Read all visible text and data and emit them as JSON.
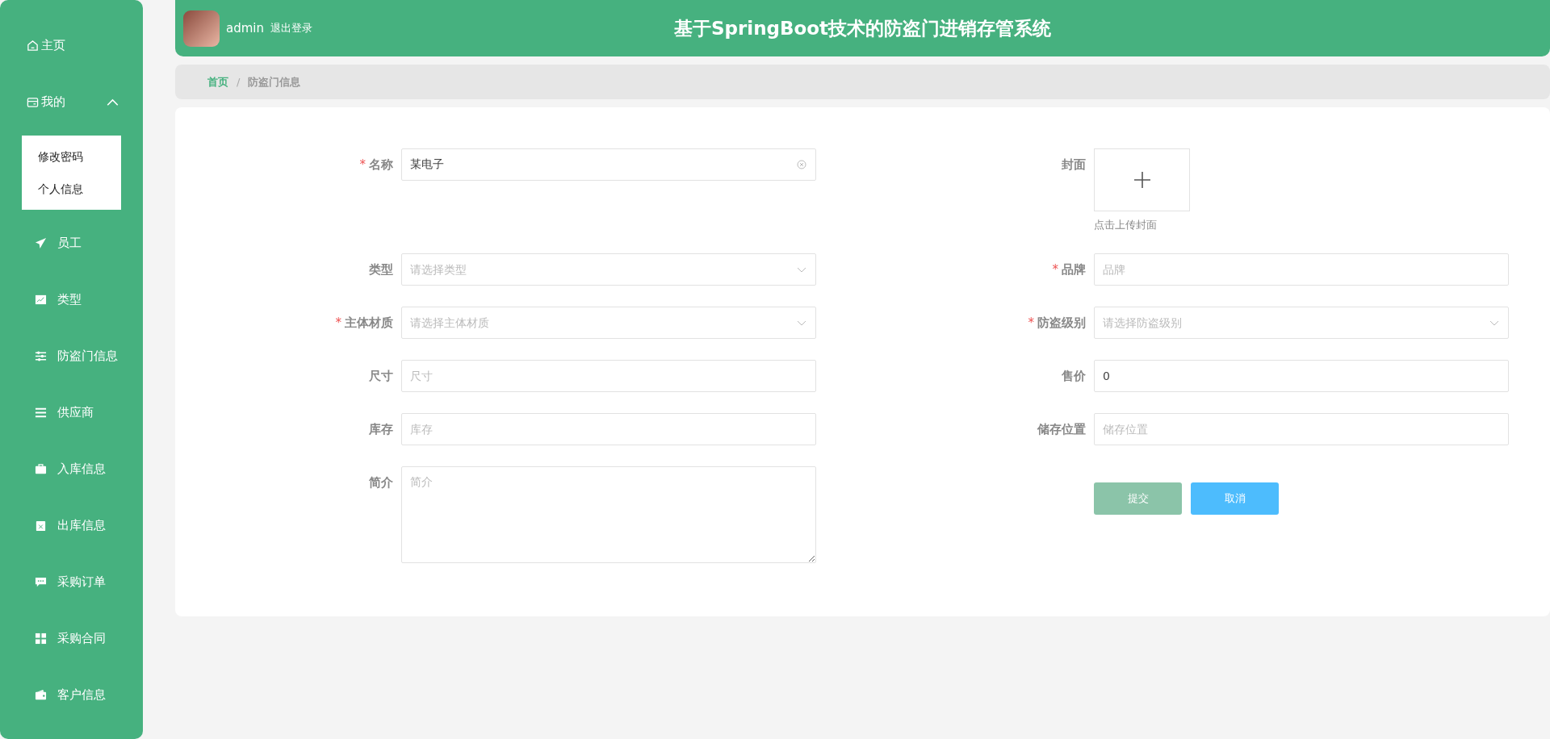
{
  "sidebar": {
    "items": [
      {
        "label": "主页"
      },
      {
        "label": "我的",
        "expanded": true,
        "children": [
          {
            "label": "修改密码"
          },
          {
            "label": "个人信息"
          }
        ]
      },
      {
        "label": "员工"
      },
      {
        "label": "类型"
      },
      {
        "label": "防盗门信息"
      },
      {
        "label": "供应商"
      },
      {
        "label": "入库信息"
      },
      {
        "label": "出库信息"
      },
      {
        "label": "采购订单"
      },
      {
        "label": "采购合同"
      },
      {
        "label": "客户信息"
      }
    ]
  },
  "header": {
    "username": "admin",
    "logout": "退出登录",
    "title": "基于SpringBoot技术的防盗门进销存管系统"
  },
  "breadcrumb": {
    "separator": "/",
    "items": [
      {
        "label": "首页"
      },
      {
        "label": "防盗门信息"
      }
    ]
  },
  "form": {
    "required_mark": "*",
    "left_column": [
      {
        "kind": "text",
        "label": "名称",
        "required": true,
        "value": "某电子",
        "clearable": true
      },
      {
        "kind": "select",
        "label": "类型",
        "required": false,
        "placeholder": "请选择类型"
      },
      {
        "kind": "select",
        "label": "主体材质",
        "required": true,
        "placeholder": "请选择主体材质"
      },
      {
        "kind": "text",
        "label": "尺寸",
        "required": false,
        "placeholder": "尺寸"
      },
      {
        "kind": "text",
        "label": "库存",
        "required": false,
        "placeholder": "库存"
      },
      {
        "kind": "textarea",
        "label": "简介",
        "required": false,
        "placeholder": "简介"
      }
    ],
    "right_column": [
      {
        "kind": "upload",
        "label": "封面",
        "required": false,
        "hint": "点击上传封面"
      },
      {
        "kind": "text",
        "label": "品牌",
        "required": true,
        "placeholder": "品牌"
      },
      {
        "kind": "select",
        "label": "防盗级别",
        "required": true,
        "placeholder": "请选择防盗级别"
      },
      {
        "kind": "text",
        "label": "售价",
        "required": false,
        "value": "0"
      },
      {
        "kind": "text",
        "label": "储存位置",
        "required": false,
        "placeholder": "储存位置"
      }
    ],
    "buttons": [
      {
        "label": "提交",
        "kind": "submit"
      },
      {
        "label": "取消",
        "kind": "cancel"
      }
    ]
  }
}
